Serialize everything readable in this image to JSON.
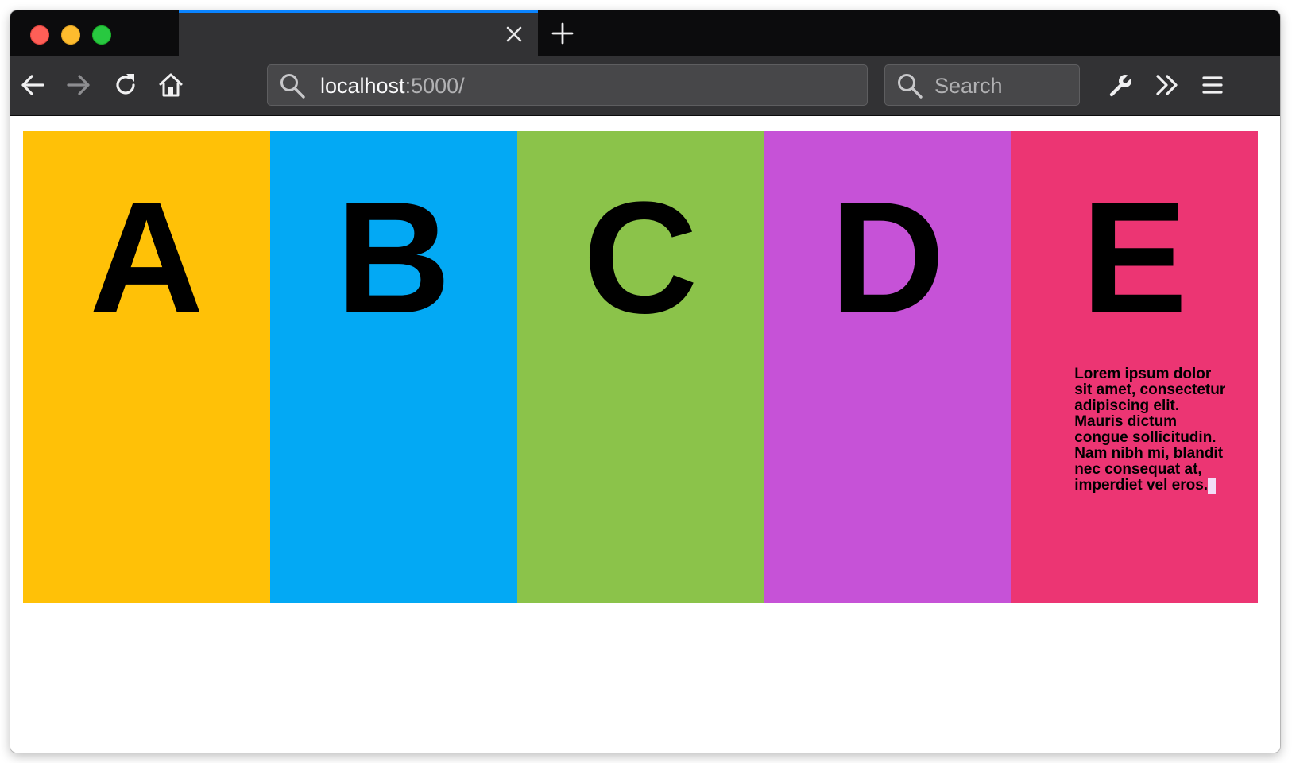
{
  "browser": {
    "tab": {
      "title": ""
    },
    "url": {
      "host": "localhost",
      "rest": ":5000/"
    },
    "search": {
      "placeholder": "Search"
    }
  },
  "colors": {
    "chrome_dark": "#0c0c0d",
    "chrome": "#323234",
    "tab_accent": "#0a84ff"
  },
  "icons": [
    "close-icon",
    "plus-icon",
    "back-arrow-icon",
    "forward-arrow-icon",
    "reload-icon",
    "home-icon",
    "search-icon",
    "wrench-icon",
    "chevron-double-right-icon",
    "hamburger-menu-icon"
  ],
  "columns": [
    {
      "letter": "A",
      "color": "#ffc107"
    },
    {
      "letter": "B",
      "color": "#03a9f4"
    },
    {
      "letter": "C",
      "color": "#8bc34a"
    },
    {
      "letter": "D",
      "color": "#c652d7"
    },
    {
      "letter": "E",
      "color": "#ec3573",
      "text": "Lorem ipsum dolor sit amet, consectetur adipiscing elit. Mauris dictum congue sollicitudin. Nam nibh mi, blandit nec consequat at, imperdiet vel eros."
    }
  ]
}
